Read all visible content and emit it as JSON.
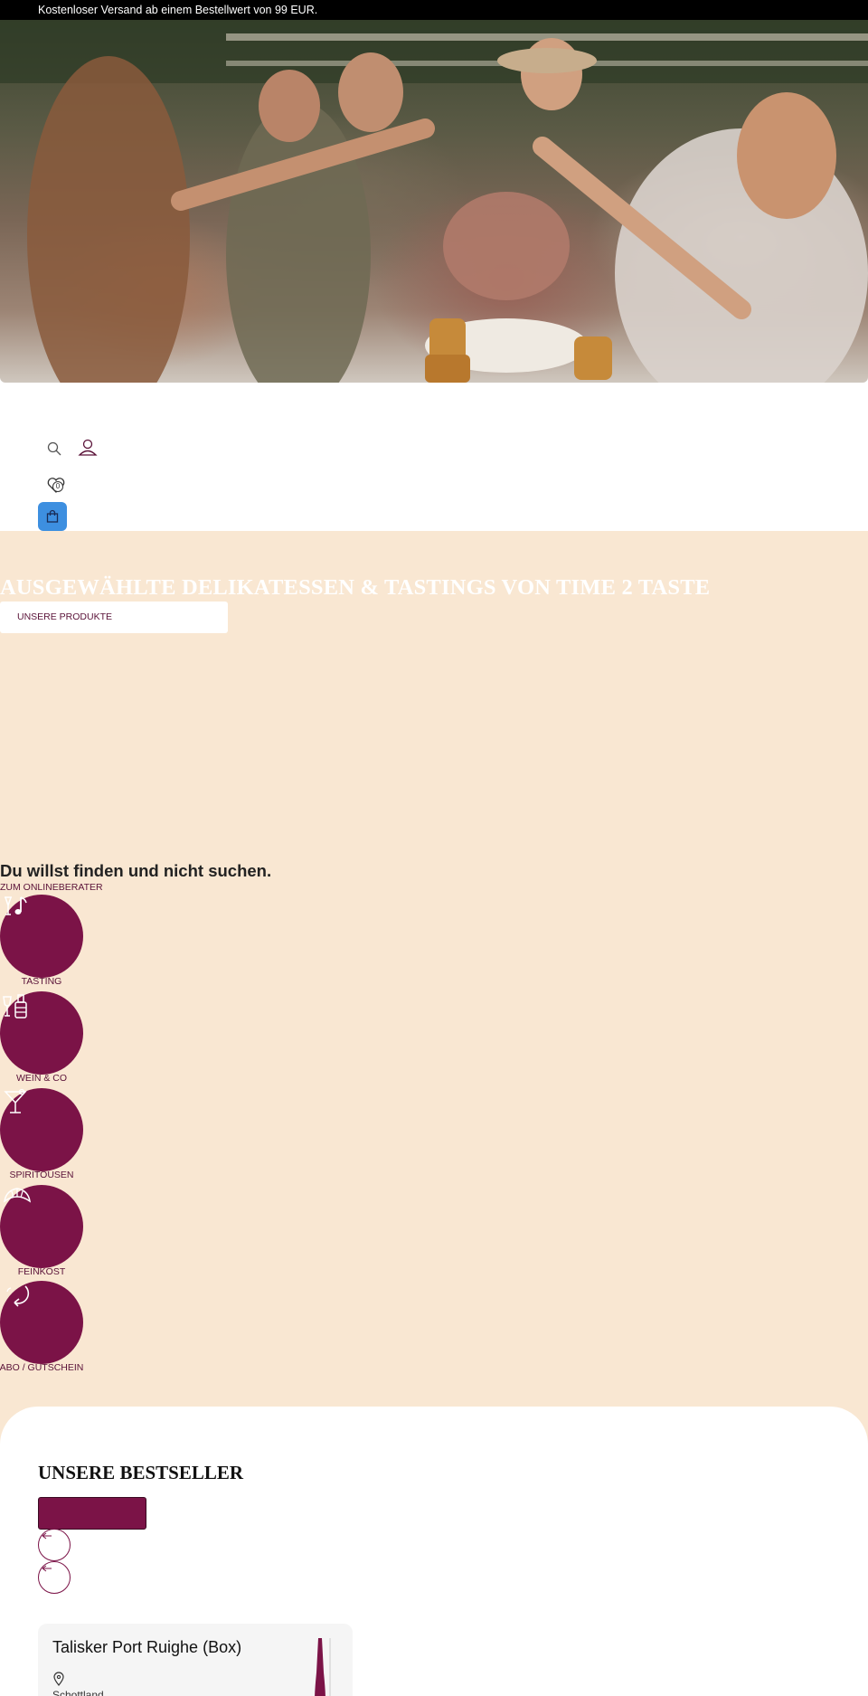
{
  "announcement": {
    "text": "Kostenloser Versand ab einem Bestellwert von 99 EUR."
  },
  "header": {
    "icons": [
      "search-icon",
      "account-icon",
      "wishlist-icon",
      "cart-icon"
    ],
    "wishlist_count": "0",
    "cart_color": "#3d8fe0"
  },
  "hero": {
    "title": "AUSGEWÄHLTE DELIKATESSEN & TASTINGS VON TIME 2 TASTE",
    "cta_label": "UNSERE PRODUKTE"
  },
  "finder": {
    "title": "Du willst finden und nicht suchen.",
    "link": "ZUM ONLINEBERATER"
  },
  "categories": [
    {
      "label": "TASTING",
      "icon": "tasting-icon"
    },
    {
      "label": "WEIN & CO",
      "icon": "wine-bottle-icon"
    },
    {
      "label": "SPIRITOUSEN",
      "icon": "cocktail-glass-icon"
    },
    {
      "label": "FEINKOST",
      "icon": "croissant-icon"
    },
    {
      "label": "ABO / GUTSCHEIN",
      "icon": "refresh-arrow-icon"
    }
  ],
  "bestsellers": {
    "title": "UNSERE BESTSELLER",
    "button_label": "",
    "product": {
      "name": "Talisker Port Ruighe (Box)",
      "origin": "Schottland"
    }
  },
  "colors": {
    "accent": "#7b1347",
    "peach": "#f9e7d2",
    "announce_bg": "#000000"
  }
}
